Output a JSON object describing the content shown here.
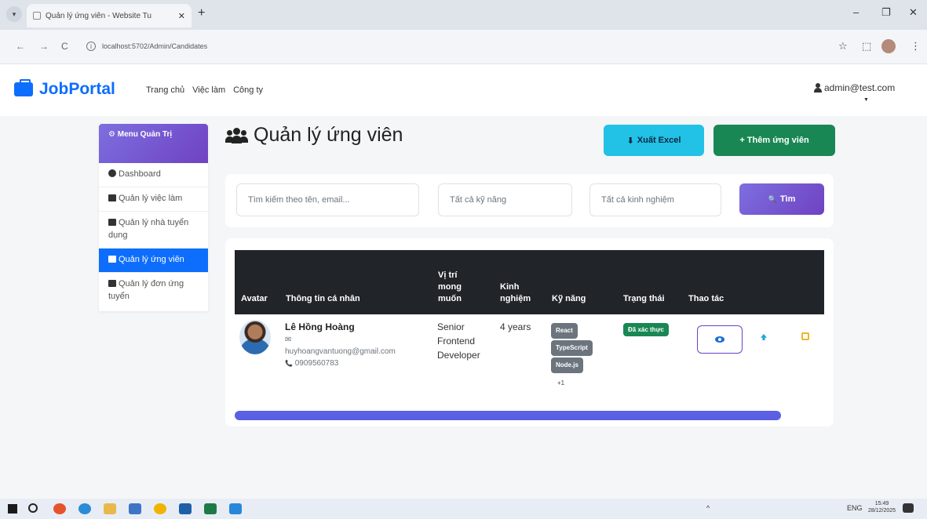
{
  "browser": {
    "tab_title": "Quản lý ứng viên - Website Tu",
    "tab_close": "✕",
    "new_tab": "+",
    "url": "localhost:5702/Admin/Candidates",
    "star": "☆",
    "ext": "⬚",
    "menu": "⋮",
    "back": "←",
    "forward": "→",
    "reload": "C",
    "minimize": "–",
    "maximize": "❐",
    "close": "✕"
  },
  "navbar": {
    "brand": "JobPortal",
    "links": [
      "Trang chủ",
      "Việc làm",
      "Công ty"
    ],
    "user": "admin@test.com",
    "caret": "▼"
  },
  "sidebar": {
    "header": "Menu Quản Trị",
    "items": [
      {
        "label": "Dashboard"
      },
      {
        "label": "Quản lý việc làm"
      },
      {
        "label": "Quản lý nhà tuyển dụng"
      },
      {
        "label": "Quản lý ứng viên"
      },
      {
        "label": "Quản lý đơn ứng tuyển"
      }
    ]
  },
  "page": {
    "title": "Quản lý ứng viên",
    "export_label": "Xuất Excel",
    "add_label": "+ Thêm ứng viên"
  },
  "filters": {
    "search_placeholder": "Tìm kiếm theo tên, email...",
    "skill_value": "Tất cả kỹ năng",
    "experience_value": "Tất cả kinh nghiệm",
    "search_button": "Tìm",
    "search_icon": "🔍"
  },
  "table": {
    "headers": {
      "avatar": "Avatar",
      "info": "Thông tin cá nhân",
      "position": "Vị trí mong muốn",
      "experience": "Kinh nghiệm",
      "skills": "Kỹ năng",
      "status": "Trạng thái",
      "actions": "Thao tác"
    },
    "rows": [
      {
        "name": "Lê Hồng Hoàng",
        "email_icon": "✉",
        "email": "huyhoangvantuong@gmail.com",
        "phone_icon": "📞",
        "phone": "0909560783",
        "position": "Senior Frontend Developer",
        "experience": "4 years",
        "skills": [
          "React",
          "TypeScript",
          "Node.js"
        ],
        "skills_more": "+1",
        "status": "Đã xác thực"
      }
    ]
  },
  "taskbar": {
    "tray_lang": "ENG",
    "time": "15:49",
    "date": "28/12/2025",
    "tray_icons": "^"
  }
}
